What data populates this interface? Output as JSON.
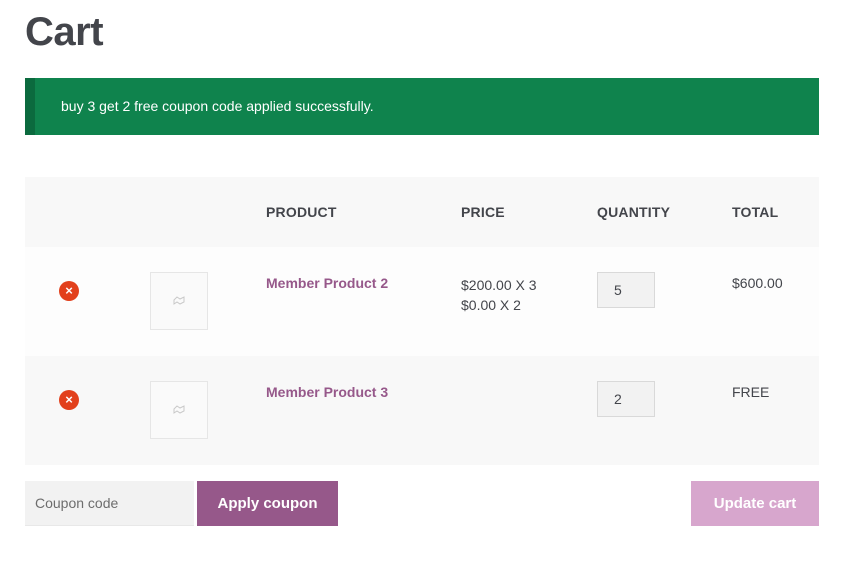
{
  "page": {
    "title": "Cart"
  },
  "notice": {
    "message": "buy 3 get 2 free coupon code applied successfully.",
    "color": "#0f834d"
  },
  "table": {
    "headers": {
      "product": "Product",
      "price": "Price",
      "quantity": "Quantity",
      "total": "Total"
    },
    "rows": [
      {
        "name": "Member Product 2",
        "price_lines": [
          "$200.00 X 3",
          "$0.00 X 2"
        ],
        "quantity": "5",
        "total": "$600.00"
      },
      {
        "name": "Member Product 3",
        "price_lines": [],
        "quantity": "2",
        "total": "FREE"
      }
    ],
    "remove_icon": "remove-circle-icon",
    "thumbnail_icon": "placeholder-image-icon"
  },
  "actions": {
    "coupon_placeholder": "Coupon code",
    "apply_label": "Apply coupon",
    "update_label": "Update cart"
  },
  "colors": {
    "accent": "#96588a",
    "remove": "#e2401c",
    "update_disabled": "#d7a6cd"
  }
}
